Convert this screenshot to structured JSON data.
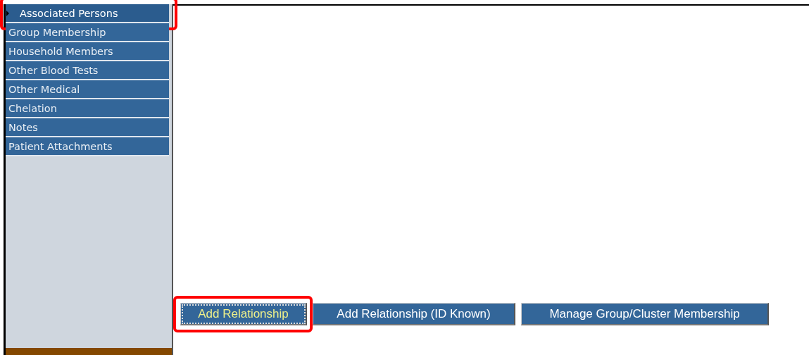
{
  "sidebar": {
    "items": [
      {
        "label": "Associated Persons",
        "selected": true,
        "highlighted": true
      },
      {
        "label": "Group Membership",
        "selected": false,
        "highlighted": false
      },
      {
        "label": "Household Members",
        "selected": false,
        "highlighted": false
      },
      {
        "label": "Other Blood Tests",
        "selected": false,
        "highlighted": false
      },
      {
        "label": "Other Medical",
        "selected": false,
        "highlighted": false
      },
      {
        "label": "Chelation",
        "selected": false,
        "highlighted": false
      },
      {
        "label": "Notes",
        "selected": false,
        "highlighted": false
      },
      {
        "label": "Patient Attachments",
        "selected": false,
        "highlighted": false
      }
    ]
  },
  "buttons": [
    {
      "label": "Add Relationship",
      "focused": true,
      "highlighted": true
    },
    {
      "label": "Add Relationship (ID Known)",
      "focused": false,
      "highlighted": false
    },
    {
      "label": "Manage Group/Cluster Membership",
      "focused": false,
      "highlighted": false
    }
  ]
}
